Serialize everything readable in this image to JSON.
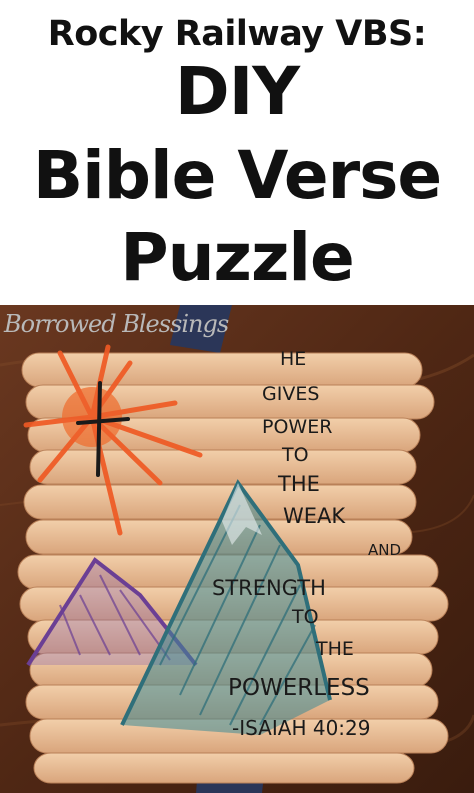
{
  "title": {
    "subtitle": "Rocky Railway VBS:",
    "line1": "DIY",
    "line2": "Bible Verse",
    "line3": "Puzzle"
  },
  "watermark": "Borrowed Blessings",
  "verse": {
    "words": [
      "HE",
      "GIVES",
      "POWER",
      "TO",
      "THE",
      "WEAK",
      "AND",
      "STRENGTH",
      "TO",
      "THE",
      "POWERLESS",
      "-ISAIAH 40:29"
    ]
  },
  "colors": {
    "table_wood": "#5a2e18",
    "stick": "#e8b890",
    "sun": "#e8622a",
    "mountain": "#3f8a93",
    "purple_hill": "#7b4a9a",
    "tape": "#2b3658"
  }
}
